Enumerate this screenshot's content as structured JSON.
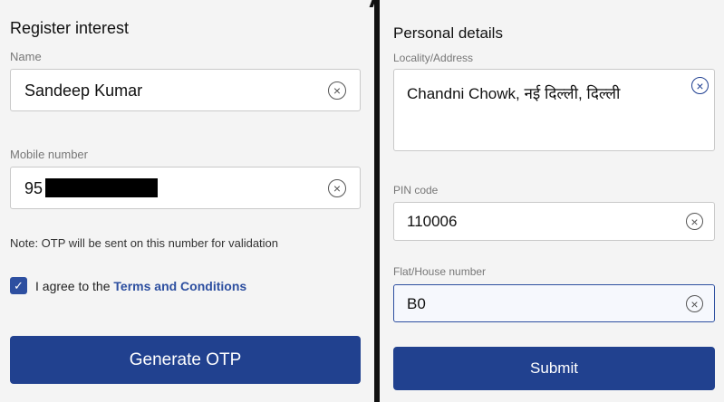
{
  "left": {
    "title": "Register interest",
    "name_label": "Name",
    "name_value": "Sandeep Kumar",
    "mobile_label": "Mobile number",
    "mobile_value": "95",
    "otp_note": "Note: OTP will be sent on this number for validation",
    "agree_text": "I agree to the ",
    "terms_link": "Terms and Conditions",
    "generate_button": "Generate OTP",
    "clear_icon": "×"
  },
  "right": {
    "title": "Personal details",
    "locality_label": "Locality/Address",
    "locality_value": "Chandni Chowk, नई दिल्ली, दिल्ली",
    "pin_label": "PIN code",
    "pin_value": "110006",
    "flat_label": "Flat/House number",
    "flat_value": "B0",
    "submit_button": "Submit",
    "clear_icon": "×"
  },
  "checkbox_mark": "✓",
  "icons": [
    "clear-circle-x-icon",
    "checkbox-check-icon"
  ],
  "colors": {
    "accent": "#21418f",
    "link": "#2d4fa0",
    "background": "#f4f4f4"
  }
}
